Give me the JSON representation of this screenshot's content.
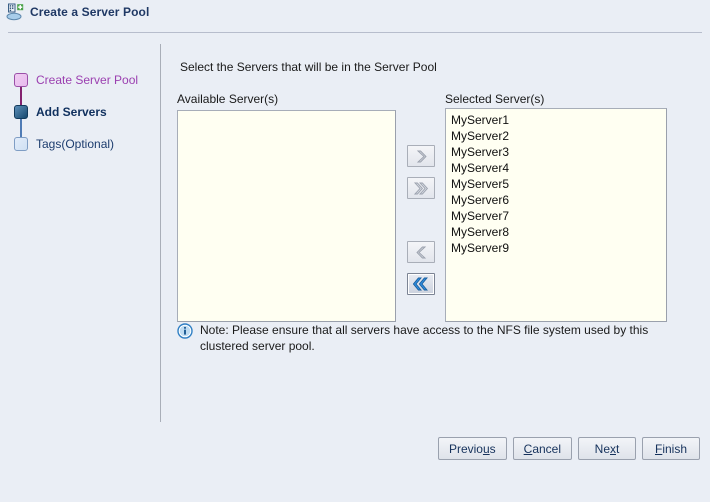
{
  "window": {
    "title": "Create a Server Pool",
    "icon": "create-server-pool-icon"
  },
  "sidebar": {
    "steps": [
      {
        "label": "Create Server Pool",
        "state": "done"
      },
      {
        "label": "Add Servers",
        "state": "current"
      },
      {
        "label": "Tags(Optional)",
        "state": "todo"
      }
    ]
  },
  "main": {
    "instruction": "Select the Servers that will be in the Server Pool",
    "available": {
      "label": "Available Server(s)",
      "items": []
    },
    "selected": {
      "label": "Selected Server(s)",
      "items": [
        "MyServer1",
        "MyServer2",
        "MyServer3",
        "MyServer4",
        "MyServer5",
        "MyServer6",
        "MyServer7",
        "MyServer8",
        "MyServer9"
      ]
    },
    "transfer_buttons": [
      {
        "name": "move-right-button",
        "glyph": "single-chevron-right",
        "enabled": false
      },
      {
        "name": "move-all-right-button",
        "glyph": "double-chevron-right",
        "enabled": false
      },
      {
        "name": "move-left-button",
        "glyph": "single-chevron-left",
        "enabled": false
      },
      {
        "name": "move-all-left-button",
        "glyph": "double-chevron-left",
        "enabled": true
      }
    ],
    "note": {
      "icon": "info-icon",
      "text": "Note: Please ensure that all servers have access to the NFS file system used by this clustered server pool."
    }
  },
  "footer": {
    "buttons": [
      {
        "name": "previous-button",
        "pre": "Previo",
        "mnemonic": "u",
        "post": "s"
      },
      {
        "name": "cancel-button",
        "pre": "",
        "mnemonic": "C",
        "post": "ancel"
      },
      {
        "name": "next-button",
        "pre": "Ne",
        "mnemonic": "x",
        "post": "t"
      },
      {
        "name": "finish-button",
        "pre": "",
        "mnemonic": "F",
        "post": "inish"
      }
    ]
  },
  "colors": {
    "background": "#eaeef5",
    "title_text": "#1f3864",
    "step_done": "#9b3fb0",
    "step_current": "#10305e",
    "step_todo": "#1c3c6e",
    "list_background": "#fffff2",
    "accent_blue": "#1b7fd4"
  }
}
